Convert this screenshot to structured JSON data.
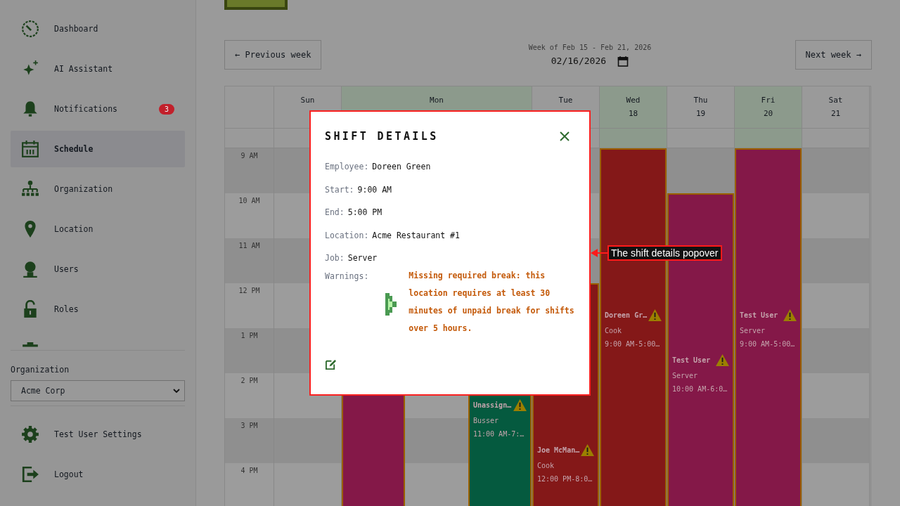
{
  "sidebar": {
    "nav_items": [
      {
        "label": "Dashboard",
        "kind": "gauge",
        "selected": false
      },
      {
        "label": "AI Assistant",
        "kind": "sparkle",
        "selected": false
      },
      {
        "label": "Notifications",
        "kind": "bell",
        "selected": false,
        "badge": "3"
      },
      {
        "label": "Schedule",
        "kind": "calendar",
        "selected": true
      },
      {
        "label": "Organization",
        "kind": "org",
        "selected": false
      },
      {
        "label": "Location",
        "kind": "pin",
        "selected": false
      },
      {
        "label": "Users",
        "kind": "user",
        "selected": false
      },
      {
        "label": "Roles",
        "kind": "lock",
        "selected": false
      }
    ],
    "organization": {
      "label": "Organization",
      "value": "Acme Corp"
    },
    "footer_items": [
      {
        "label": "Test User Settings",
        "kind": "gear"
      },
      {
        "label": "Logout",
        "kind": "exit"
      }
    ]
  },
  "week_nav": {
    "previous": "← Previous week",
    "caption": "Week of Feb 15 - Feb 21, 2026",
    "date": "02/16/2026",
    "next": "Next week →"
  },
  "calendar": {
    "hours": [
      "9 AM",
      "10 AM",
      "11 AM",
      "12 PM",
      "1 PM",
      "2 PM",
      "3 PM",
      "4 PM"
    ],
    "days": [
      {
        "name": "Sun",
        "highlighted": false
      },
      {
        "name": "Mon",
        "highlighted": true,
        "lanes": [
          {
            "cells": [
              {
                "kind": "shift",
                "color": "#841848"
              }
            ]
          },
          {
            "cells": [
              {
                "kind": "empty"
              }
            ]
          },
          {
            "cells": [
              {
                "kind": "empty"
              },
              {
                "kind": "empty"
              },
              {
                "kind": "shift",
                "color": "#055a3f",
                "employee": "Unassign…",
                "warning": true,
                "job": "Busser",
                "time": "11:00 AM-7:…"
              }
            ]
          }
        ]
      },
      {
        "name": "Tue",
        "highlighted": false,
        "lanes": [
          {
            "cells": [
              {
                "kind": "empty"
              },
              {
                "kind": "empty"
              },
              {
                "kind": "empty"
              },
              {
                "kind": "shift",
                "color": "#841818",
                "employee": "Joe McMan…",
                "warning": true,
                "job": "Cook",
                "time": "12:00 PM-8:0…"
              }
            ]
          }
        ]
      },
      {
        "name": "Wed",
        "date": "18",
        "highlighted": true,
        "lanes": [
          {
            "cells": [
              {
                "kind": "shift",
                "color": "#841818",
                "employee": "Doreen Gr…",
                "warning": true,
                "job": "Cook",
                "time": "9:00 AM-5:00…"
              }
            ]
          }
        ]
      },
      {
        "name": "Thu",
        "date": "19",
        "highlighted": false,
        "lanes": [
          {
            "cells": [
              {
                "kind": "empty"
              },
              {
                "kind": "shift",
                "color": "#841848",
                "employee": "Test User",
                "warning": true,
                "job": "Server",
                "time": "10:00 AM-6:0…"
              }
            ]
          }
        ]
      },
      {
        "name": "Fri",
        "date": "20",
        "highlighted": true,
        "lanes": [
          {
            "cells": [
              {
                "kind": "shift",
                "color": "#841848",
                "employee": "Test User",
                "warning": true,
                "job": "Server",
                "time": "9:00 AM-5:00…"
              }
            ]
          }
        ]
      },
      {
        "name": "Sat",
        "date": "21",
        "highlighted": false
      }
    ]
  },
  "popover": {
    "title": "SHIFT DETAILS",
    "fields": [
      {
        "label": "Employee:",
        "value": "Doreen Green"
      },
      {
        "label": "Start:",
        "value": "9:00 AM"
      },
      {
        "label": "End:",
        "value": "5:00 PM"
      },
      {
        "label": "Location:",
        "value": "Acme Restaurant #1"
      },
      {
        "label": "Job:",
        "value": "Server"
      }
    ],
    "warnings": {
      "label": "Warnings:",
      "items": [
        "Missing required break: this location requires at least 30 minutes of unpaid break for shifts over 5 hours."
      ]
    }
  },
  "annotation": {
    "text": "The shift details popover"
  }
}
